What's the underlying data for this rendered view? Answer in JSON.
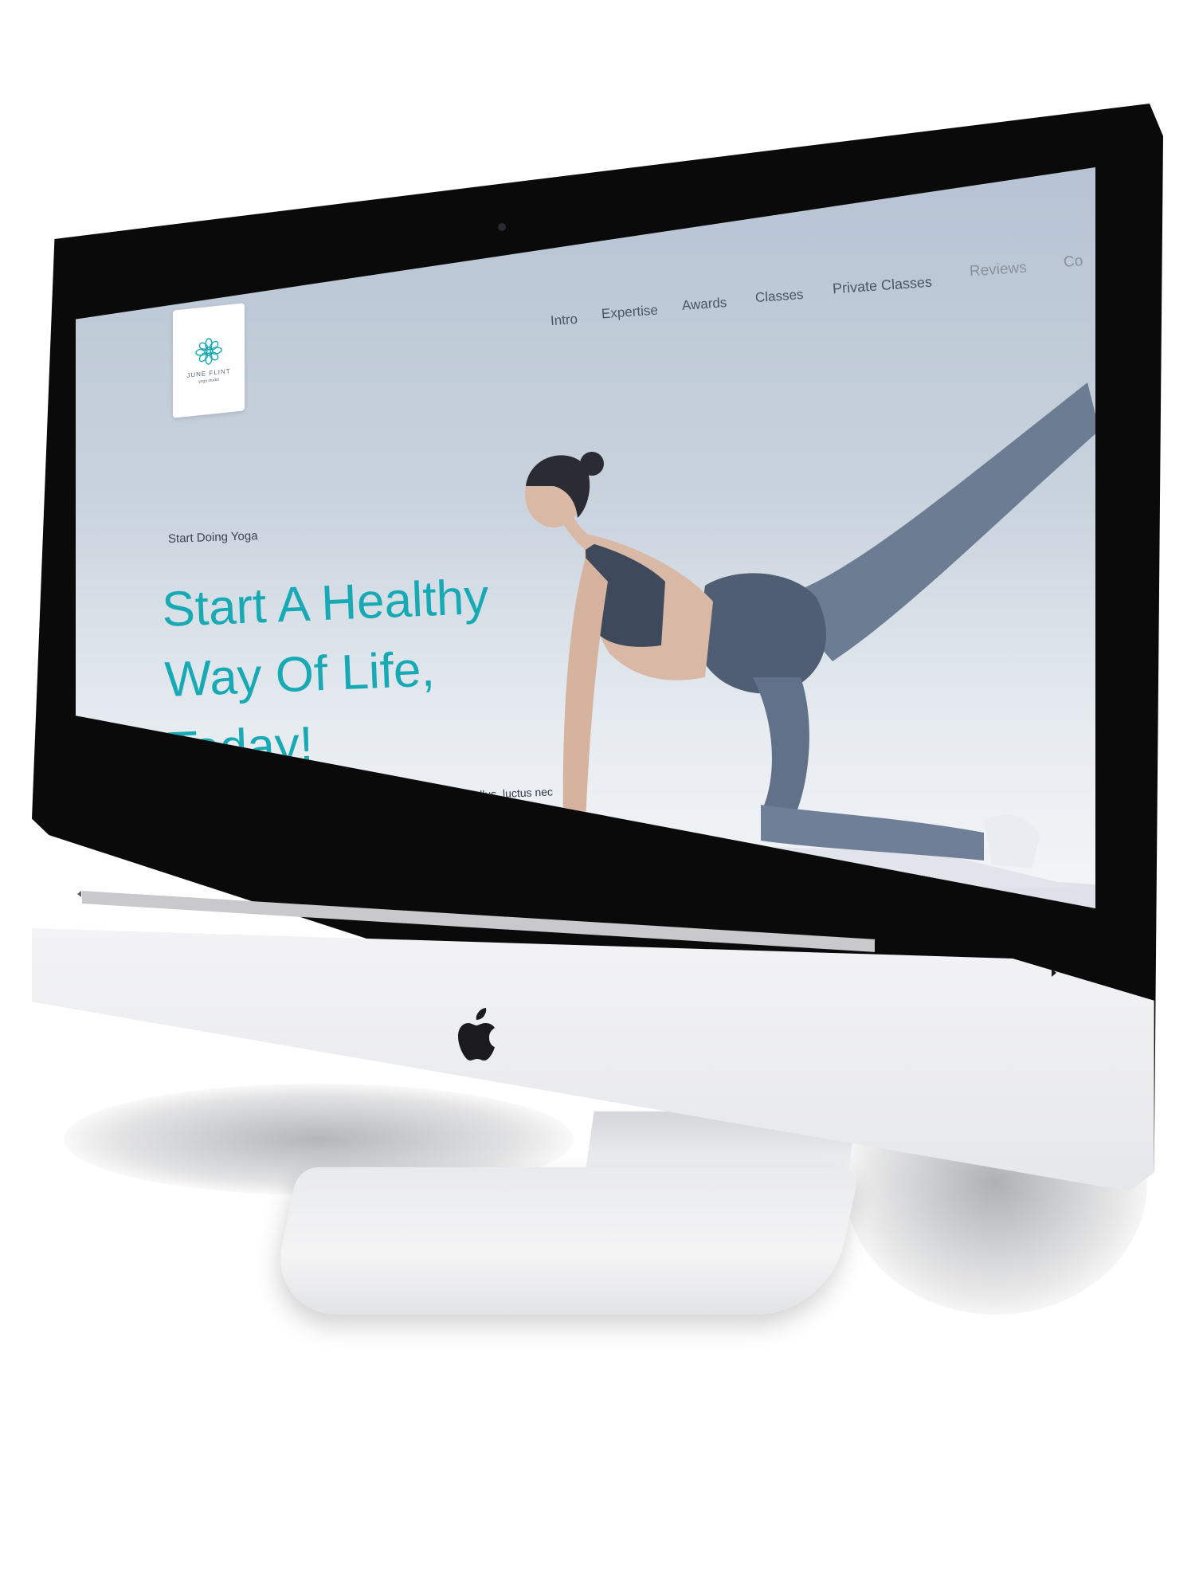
{
  "brand": {
    "name": "JUNE FLINT",
    "tagline": "yoga studio",
    "accent_color": "#17aab4"
  },
  "nav": {
    "items": [
      {
        "label": "Intro"
      },
      {
        "label": "Expertise"
      },
      {
        "label": "Awards"
      },
      {
        "label": "Classes"
      },
      {
        "label": "Private Classes"
      },
      {
        "label": "Reviews"
      },
      {
        "label": "Co"
      }
    ]
  },
  "hero": {
    "eyebrow": "Start Doing Yoga",
    "headline": "Start A Healthy Way Of Life, Today!",
    "body": "Lorem ipsum dolor sit amet, consectetur adipiscing elit. Ut elit tellus, luctus nec ullamcorper mattis, pulvinar dapibus leo.",
    "image_icon": "woman-doing-yoga-image"
  },
  "device": {
    "logo_icon": "apple-logo-icon"
  }
}
